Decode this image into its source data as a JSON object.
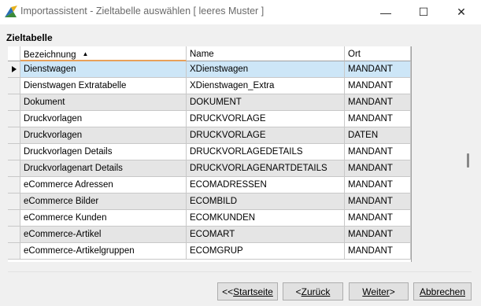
{
  "window": {
    "title": "Importassistent - Zieltabelle auswählen [ leeres Muster ]",
    "minimize_glyph": "—",
    "maximize_glyph": "☐",
    "close_glyph": "✕"
  },
  "section": {
    "title": "Zieltabelle"
  },
  "table": {
    "columns": [
      {
        "label": "Bezeichnung",
        "sorted": "ascending"
      },
      {
        "label": "Name"
      },
      {
        "label": "Ort"
      }
    ],
    "selected_row": 0,
    "rows": [
      [
        "Dienstwagen",
        "XDienstwagen",
        "MANDANT"
      ],
      [
        "Dienstwagen Extratabelle",
        "XDienstwagen_Extra",
        "MANDANT"
      ],
      [
        "Dokument",
        "DOKUMENT",
        "MANDANT"
      ],
      [
        "Druckvorlagen",
        "DRUCKVORLAGE",
        "MANDANT"
      ],
      [
        "Druckvorlagen",
        "DRUCKVORLAGE",
        "DATEN"
      ],
      [
        "Druckvorlagen Details",
        "DRUCKVORLAGEDETAILS",
        "MANDANT"
      ],
      [
        "Druckvorlagenart Details",
        "DRUCKVORLAGENARTDETAILS",
        "MANDANT"
      ],
      [
        "eCommerce Adressen",
        "ECOMADRESSEN",
        "MANDANT"
      ],
      [
        "eCommerce Bilder",
        "ECOMBILD",
        "MANDANT"
      ],
      [
        "eCommerce Kunden",
        "ECOMKUNDEN",
        "MANDANT"
      ],
      [
        "eCommerce-Artikel",
        "ECOMART",
        "MANDANT"
      ],
      [
        "eCommerce-Artikelgruppen",
        "ECOMGRUP",
        "MANDANT"
      ]
    ]
  },
  "buttons": {
    "start_prefix": "<< ",
    "start_label": "Startseite",
    "back_prefix": "< ",
    "back_label": "Zurück",
    "next_label": "Weiter",
    "next_suffix": " >",
    "cancel_label": "Abbrechen"
  }
}
